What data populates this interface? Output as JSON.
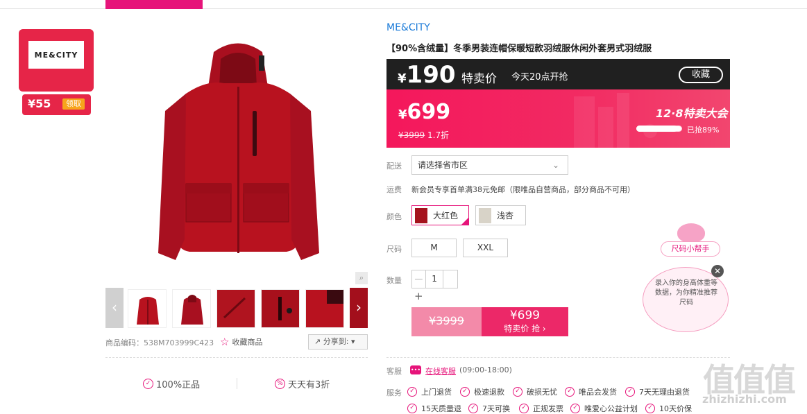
{
  "coupon": {
    "logo": "ME&CITY",
    "amount": "¥55",
    "get_label": "领取"
  },
  "product_gallery": {
    "zoom_icon": "magnifier-icon",
    "prev_arrow": "‹",
    "next_arrow": "›",
    "code_label": "商品编码：538M703999C423",
    "favorite_label": "收藏商品",
    "share_label": "分享到:",
    "share_chevron": "▾",
    "guarantees": [
      "100%正品",
      "天天有3折"
    ]
  },
  "brand": "ME&CITY",
  "title": "【90%含绒量】冬季男装连帽保暖短款羽绒服休闲外套男式羽绒服",
  "promo": {
    "special_price_symbol": "¥",
    "special_price": "190",
    "special_label": "特卖价",
    "start_time": "今天20点开抢",
    "favorite_button": "收藏",
    "current_price_symbol": "¥",
    "current_price": "699",
    "original_price": "¥3999",
    "discount": "1.7折",
    "event_label": "12·8特卖大会",
    "sold_percent": 0.89,
    "sold_label": "已抢89%"
  },
  "delivery": {
    "label": "配送",
    "placeholder": "请选择省市区",
    "chevron": "⌄"
  },
  "shipping": {
    "label": "运费",
    "text": "新会员专享首单满38元免邮（限唯品自营商品，部分商品不可用）"
  },
  "colors": {
    "label": "颜色",
    "options": [
      {
        "name": "大红色",
        "swatch": "#a5121d",
        "selected": true
      },
      {
        "name": "浅杏",
        "swatch": "#d8d3c8",
        "selected": false
      }
    ]
  },
  "sizes": {
    "label": "尺码",
    "options": [
      "M",
      "XXL"
    ]
  },
  "quantity": {
    "label": "数量",
    "minus": "—",
    "value": "1",
    "plus": "+"
  },
  "buy": {
    "original_price": "¥3999",
    "price": "¥699",
    "label": "特卖价 抢"
  },
  "customer_service": {
    "label": "客服",
    "link": "在线客服",
    "hours": "(09:00-18:00)"
  },
  "services": {
    "label": "服务",
    "row1": [
      "上门退货",
      "极速退款",
      "破损无忧",
      "唯品会发货",
      "7天无理由退货"
    ],
    "row2": [
      "15天质量退",
      "7天可换",
      "正规发票",
      "唯爱心公益计划",
      "10天价保"
    ]
  },
  "size_helper": {
    "tag": "尺码小帮手",
    "text": "录入你的身高体重等数据，为你精准推荐尺码",
    "close": "✕"
  },
  "watermark": {
    "main": "值值值",
    "sub": "zhizhizhi.com"
  },
  "colors_theme": {
    "accent": "#e6147a",
    "promo_pink": "#f4175c",
    "link_blue": "#1a7ad8"
  }
}
